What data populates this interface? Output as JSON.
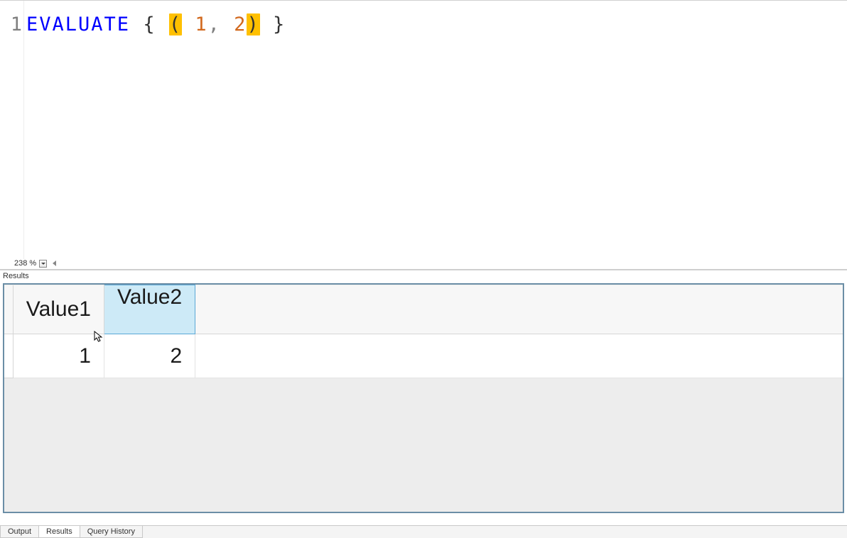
{
  "editor": {
    "line_number": "1",
    "token_keyword": "EVALUATE",
    "token_space1": " ",
    "token_open_brace": "{",
    "token_space2": " ",
    "token_open_paren": "(",
    "token_space3": " ",
    "token_num1": "1",
    "token_comma": ",",
    "token_space4": " ",
    "token_num2": "2",
    "token_close_paren": ")",
    "token_space5": " ",
    "token_close_brace": "}",
    "zoom_level": "238 %"
  },
  "panel": {
    "title": "Results"
  },
  "grid": {
    "headers": [
      "Value1",
      "Value2"
    ],
    "selected_header_index": 1,
    "rows": [
      [
        "1",
        "2"
      ]
    ]
  },
  "tabs": {
    "items": [
      "Output",
      "Results",
      "Query History"
    ],
    "active_index": 1
  }
}
